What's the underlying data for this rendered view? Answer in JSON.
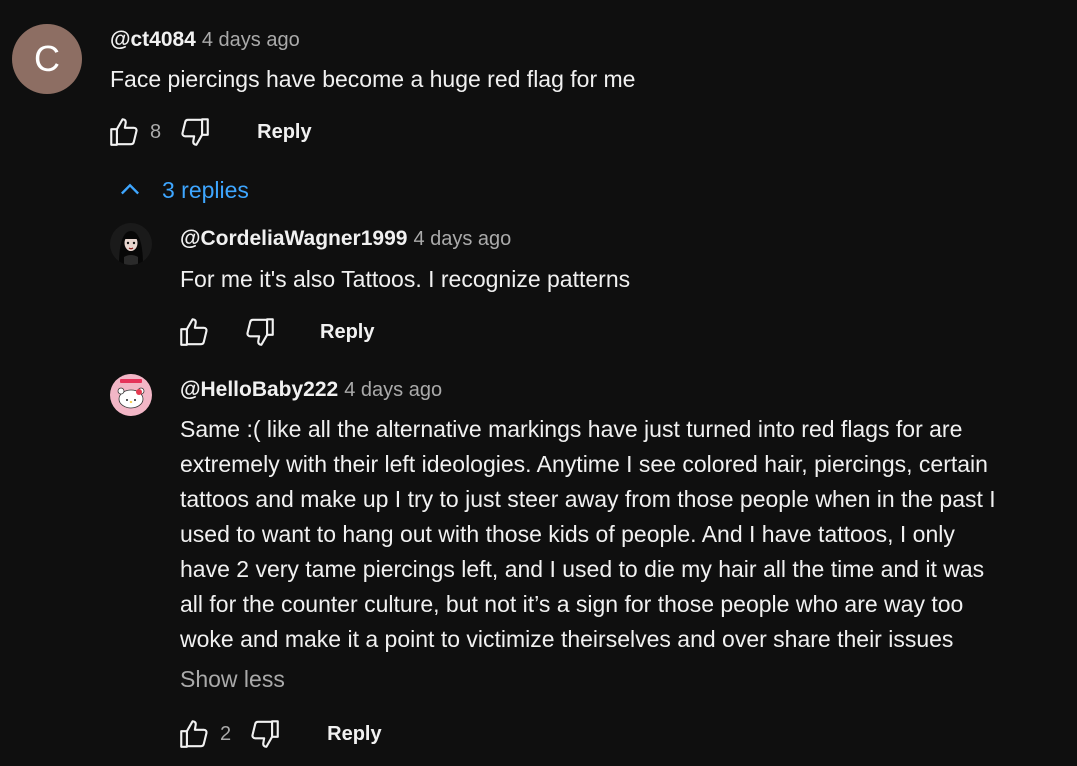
{
  "comment": {
    "avatar_letter": "C",
    "handle": "@ct4084",
    "time": "4 days ago",
    "text": "Face piercings have become a huge red flag for me",
    "likes": "8",
    "reply_label": "Reply"
  },
  "replies_toggle": {
    "label": "3 replies",
    "icon": "chevron-up-icon"
  },
  "replies": [
    {
      "handle": "@CordeliaWagner1999",
      "time": "4 days ago",
      "text": "For me it's also Tattoos. I recognize patterns",
      "likes": "",
      "reply_label": "Reply"
    },
    {
      "handle": "@HelloBaby222",
      "time": "4 days ago",
      "lines": [
        "Same :( like all the alternative markings have just turned into red flags for are",
        "extremely with their left ideologies. Anytime I see colored hair, piercings, certain",
        "tattoos and make up I try to just steer away from those people when in the past I",
        "used to want to hang out with those kids of people. And I have tattoos, I only",
        "have 2 very tame piercings left, and I used to die my hair all the time and it was",
        "all for the counter culture, but not it’s a sign for those people who are way too",
        "woke and make it a point to victimize theirselves and over share their issues"
      ],
      "show_less": "Show less",
      "likes": "2",
      "reply_label": "Reply"
    }
  ],
  "colors": {
    "background": "#0f0f0f",
    "link": "#3ea6ff",
    "muted": "#aaaaaa"
  }
}
